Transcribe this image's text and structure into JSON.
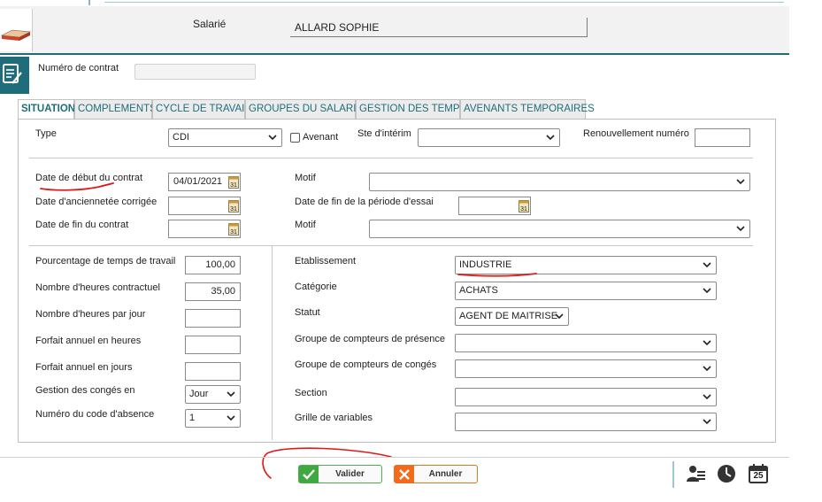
{
  "header": {
    "salarie_label": "Salarié",
    "salarie_value": "ALLARD SOPHIE",
    "contract_label": "Numéro de contrat",
    "contract_value": ""
  },
  "tabs": [
    {
      "label": "SITUATION",
      "active": true
    },
    {
      "label": "COMPLEMENTS",
      "active": false
    },
    {
      "label": "CYCLE DE TRAVAIL",
      "active": false
    },
    {
      "label": "GROUPES DU SALARIE",
      "active": false
    },
    {
      "label": "GESTION DES TEMPS",
      "active": false
    },
    {
      "label": "AVENANTS TEMPORAIRES",
      "active": false
    }
  ],
  "situation": {
    "type_label": "Type",
    "type_value": "CDI",
    "avenant_label": "Avenant",
    "avenant_checked": false,
    "ste_interim_label": "Ste d'intérim",
    "ste_interim_value": "",
    "renouvellement_label": "Renouvellement numéro",
    "renouvellement_value": "",
    "date_debut_label": "Date de début du contrat",
    "date_debut_value": "04/01/2021",
    "motif1_label": "Motif",
    "motif1_value": "",
    "date_anciennete_label": "Date d'anciennetée corrigée",
    "date_anciennete_value": "",
    "date_fin_essai_label": "Date de fin de la période d'essai",
    "date_fin_essai_value": "",
    "date_fin_label": "Date de fin du contrat",
    "date_fin_value": "",
    "motif2_label": "Motif",
    "motif2_value": "",
    "pourcentage_label": "Pourcentage de temps de travail",
    "pourcentage_value": "100,00",
    "heures_contract_label": "Nombre d'heures contractuel",
    "heures_contract_value": "35,00",
    "heures_jour_label": "Nombre d'heures par jour",
    "heures_jour_value": "",
    "forfait_heures_label": "Forfait annuel en heures",
    "forfait_heures_value": "",
    "forfait_jours_label": "Forfait annuel en jours",
    "forfait_jours_value": "",
    "conges_label": "Gestion des congés en",
    "conges_value": "Jour",
    "code_absence_label": "Numéro du code d'absence",
    "code_absence_value": "1",
    "etablissement_label": "Etablissement",
    "etablissement_value": "INDUSTRIE",
    "categorie_label": "Catégorie",
    "categorie_value": "ACHATS",
    "statut_label": "Statut",
    "statut_value": "AGENT DE MAITRISE",
    "groupe_presence_label": "Groupe de compteurs de présence",
    "groupe_presence_value": "",
    "groupe_conges_label": "Groupe de compteurs de congés",
    "groupe_conges_value": "",
    "section_label": "Section",
    "section_value": "",
    "grille_label": "Grille de variables",
    "grille_value": ""
  },
  "footer": {
    "valider_label": "Valider",
    "annuler_label": "Annuler",
    "calendar_day": "25"
  },
  "colors": {
    "accent": "#1f6d7a",
    "valider_green": "#3fa83f",
    "annuler_orange": "#f26a1b",
    "annotation_red": "#e01818"
  }
}
